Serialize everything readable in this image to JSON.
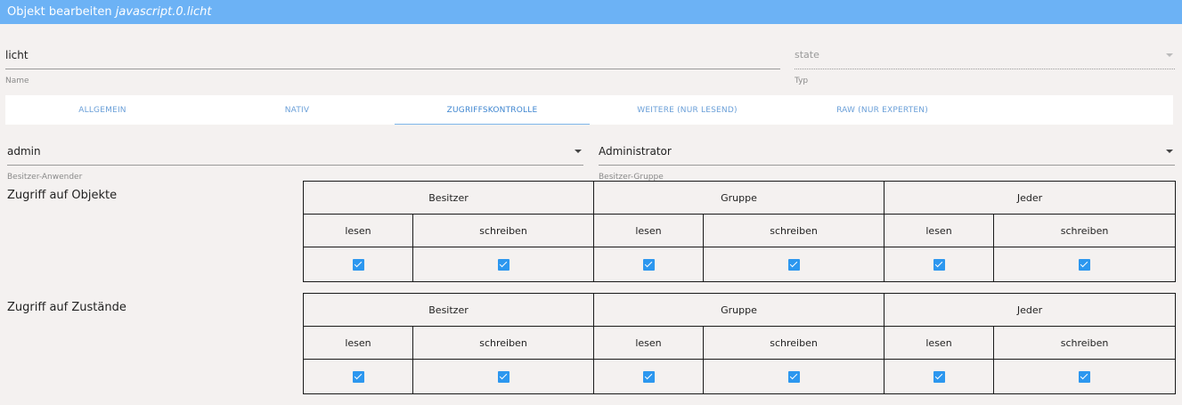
{
  "header": {
    "title_prefix": "Objekt bearbeiten",
    "object_id": "javascript.0.licht"
  },
  "name_field": {
    "value": "licht",
    "help": "Name"
  },
  "type_field": {
    "value": "state",
    "help": "Typ"
  },
  "tabs": [
    {
      "label": "ALLGEMEIN",
      "active": false
    },
    {
      "label": "NATIV",
      "active": false
    },
    {
      "label": "ZUGRIFFSKONTROLLE",
      "active": true
    },
    {
      "label": "WEITERE (NUR LESEND)",
      "active": false
    },
    {
      "label": "RAW (NUR EXPERTEN)",
      "active": false
    }
  ],
  "owner_user": {
    "value": "admin",
    "help": "Besitzer-Anwender"
  },
  "owner_group": {
    "value": "Administrator",
    "help": "Besitzer-Gruppe"
  },
  "permissions": {
    "groups": [
      "Besitzer",
      "Gruppe",
      "Jeder"
    ],
    "ops": [
      "lesen",
      "schreiben"
    ],
    "objects": {
      "label": "Zugriff auf Objekte",
      "checked": [
        true,
        true,
        true,
        true,
        true,
        true
      ]
    },
    "states": {
      "label": "Zugriff auf Zustände",
      "checked": [
        true,
        true,
        true,
        true,
        true,
        true
      ]
    }
  },
  "colors": {
    "accent": "#6cb2f5",
    "checkbox": "#2c97ef",
    "tab_text": "#6a9fd8"
  }
}
